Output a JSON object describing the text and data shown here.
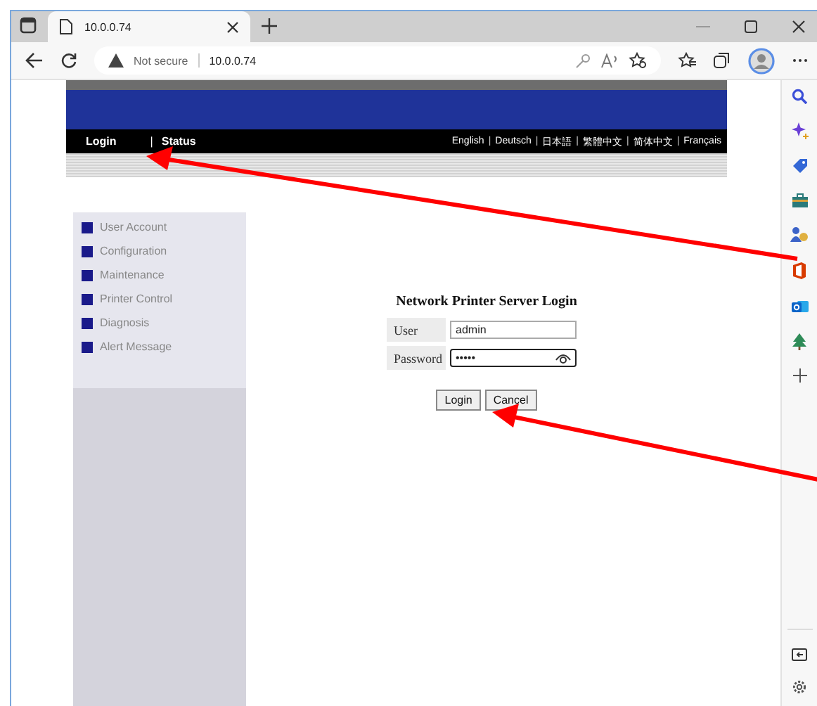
{
  "browser": {
    "tab_title": "10.0.0.74",
    "security": "Not secure",
    "url": "10.0.0.74"
  },
  "nav": {
    "items": [
      {
        "label": "Login"
      },
      {
        "label": "|"
      },
      {
        "label": "Status"
      }
    ],
    "languages": [
      {
        "label": "English",
        "kind": "link"
      },
      {
        "label": "|",
        "kind": "separator"
      },
      {
        "label": "Deutsch",
        "kind": "link"
      },
      {
        "label": "|",
        "kind": "separator"
      },
      {
        "label": "日本語",
        "kind": "link"
      },
      {
        "label": "|",
        "kind": "separator"
      },
      {
        "label": "繁體中文",
        "kind": "link"
      },
      {
        "label": "|",
        "kind": "separator"
      },
      {
        "label": "简体中文",
        "kind": "link"
      },
      {
        "label": "|",
        "kind": "separator"
      },
      {
        "label": "Français",
        "kind": "link"
      }
    ]
  },
  "sidebar": {
    "items": [
      "User Account",
      "Configuration",
      "Maintenance",
      "Printer Control",
      "Diagnosis",
      "Alert Message"
    ]
  },
  "login": {
    "title": "Network Printer Server Login",
    "fields": [
      {
        "label": "User",
        "value": "admin",
        "kind": "text"
      },
      {
        "label": "Password",
        "value": "•••••",
        "kind": "password"
      }
    ],
    "buttons": [
      "Login",
      "Cancel"
    ]
  }
}
